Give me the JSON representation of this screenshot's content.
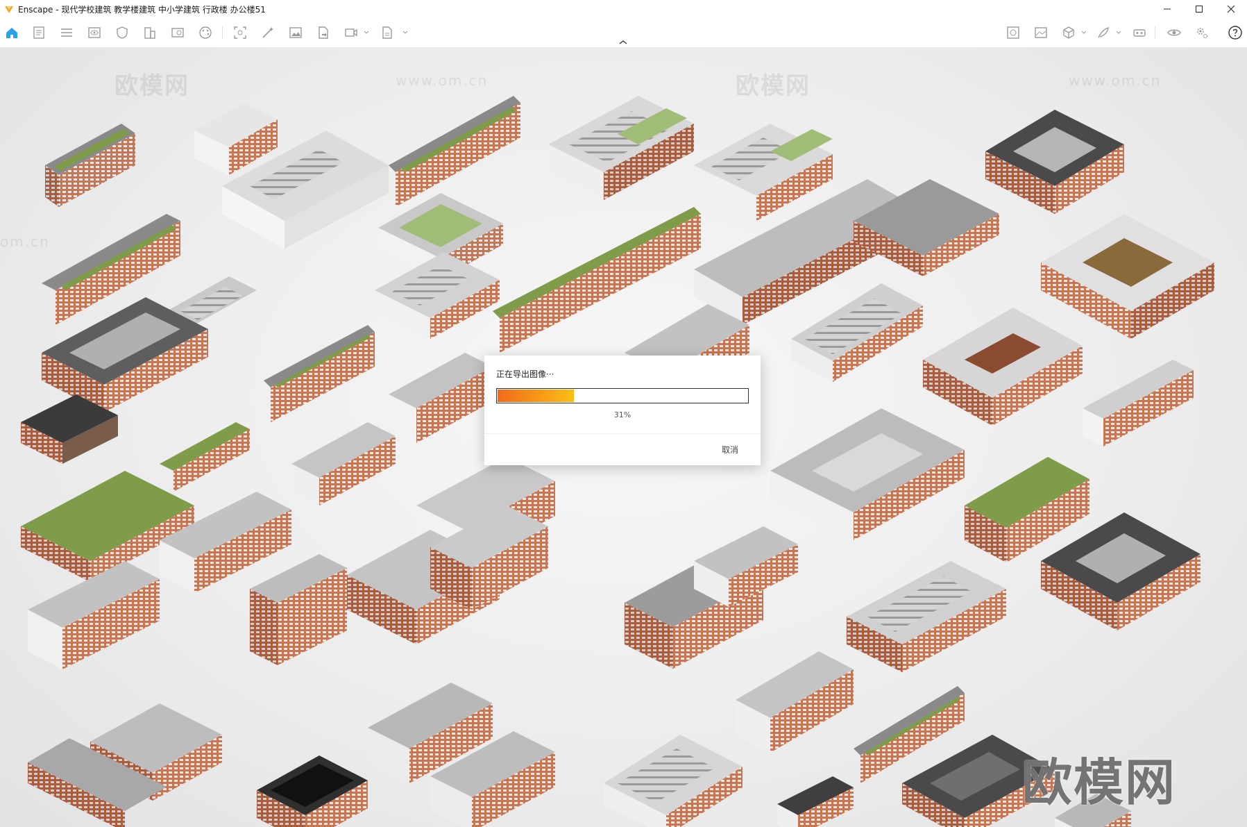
{
  "app": {
    "title": "Enscape - 现代学校建筑 教学楼建筑 中小学建筑 行政楼 办公楼51",
    "brand_color": "#f5a623"
  },
  "window_controls": {
    "icons": [
      "minimize-icon",
      "maximize-icon",
      "close-icon"
    ]
  },
  "toolbar": {
    "left_icons": [
      "home-icon",
      "document-icon",
      "layers-icon",
      "eye-frame-icon",
      "shield-icon",
      "building-icon",
      "asset-library-icon",
      "palette-icon",
      "capture-icon",
      "magic-wand-icon",
      "image-icon",
      "export-file-icon",
      "video-icon",
      "batch-render-icon"
    ],
    "right_icons": [
      "material-icon",
      "landscape-icon",
      "cube-icon",
      "feather-icon",
      "vr-headset-icon",
      "view-eye-icon",
      "settings-icon",
      "help-icon"
    ],
    "accent_color": "#2aa0f0"
  },
  "viewport": {
    "watermarks": [
      "欧模网",
      "www.om.cn",
      "om.cn",
      "欧模网",
      "www.om.cn"
    ],
    "large_watermark": "欧模网"
  },
  "dialog": {
    "title": "正在导出图像···",
    "progress_percent": 31,
    "progress_text": "31%",
    "cancel_label": "取消"
  }
}
